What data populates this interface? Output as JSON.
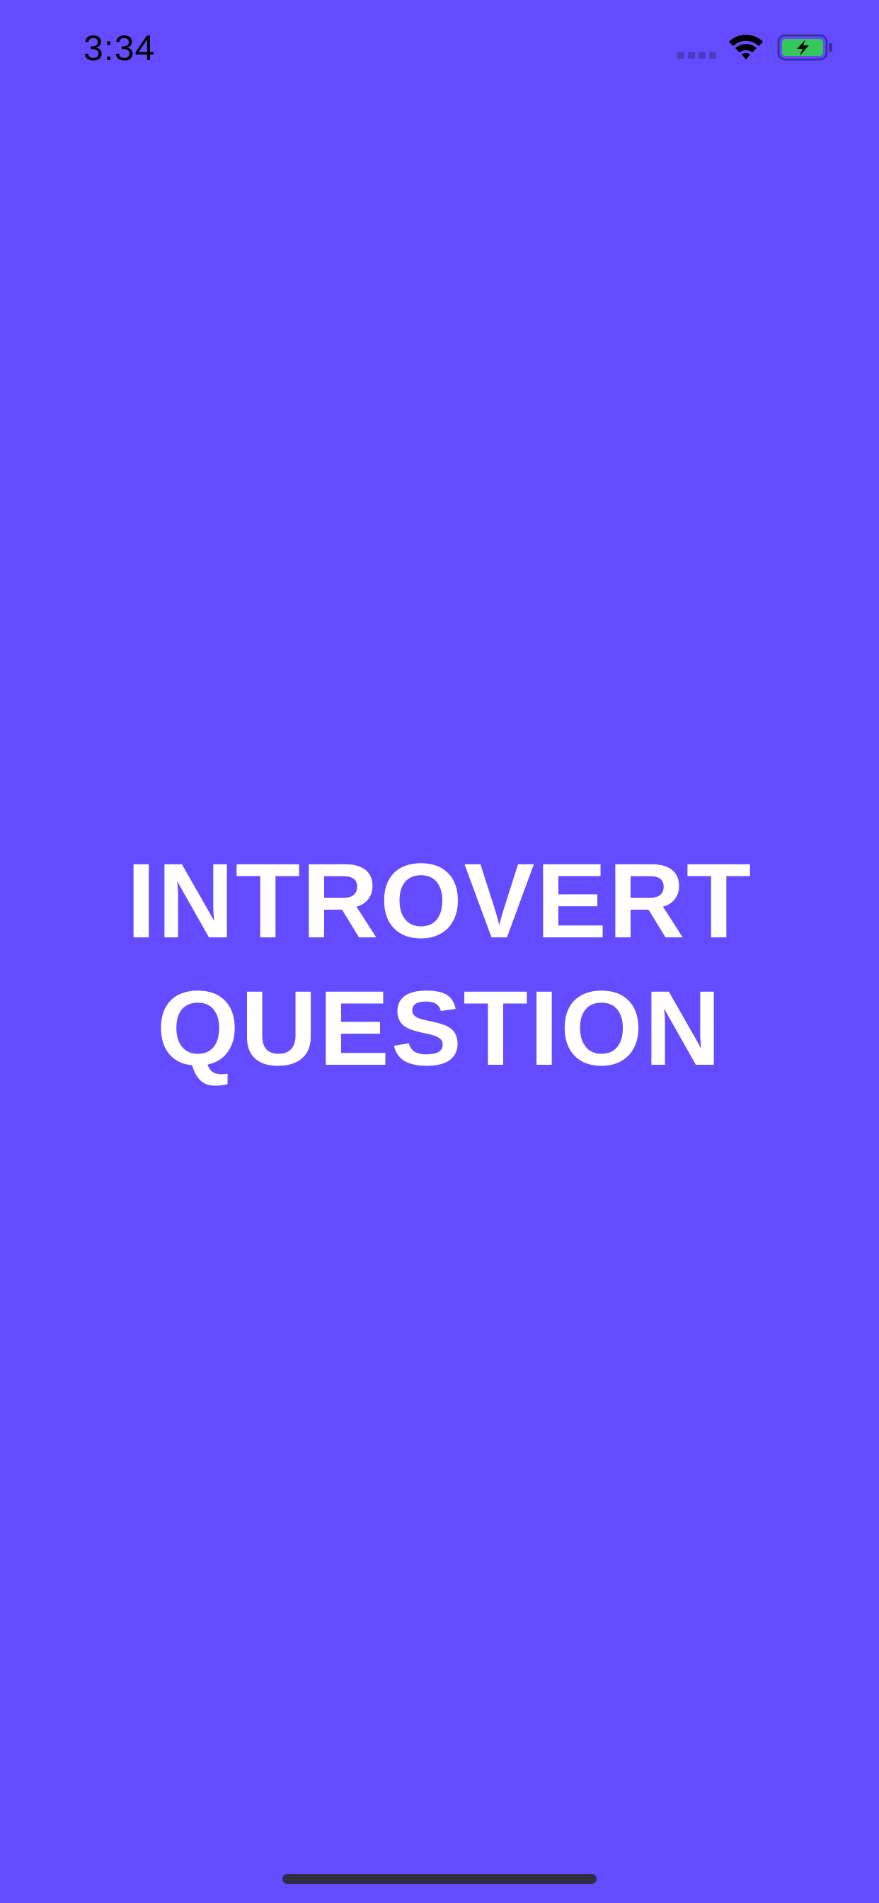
{
  "status_bar": {
    "time": "3:34",
    "signal_icon": "cellular-signal-icon",
    "wifi_icon": "wifi-icon",
    "battery_icon": "battery-charging-icon",
    "battery_color": "#34c759"
  },
  "splash": {
    "title_line_1": "INTROVERT",
    "title_line_2": "QUESTION",
    "background_color": "#634bff",
    "text_color": "#ffffff"
  }
}
